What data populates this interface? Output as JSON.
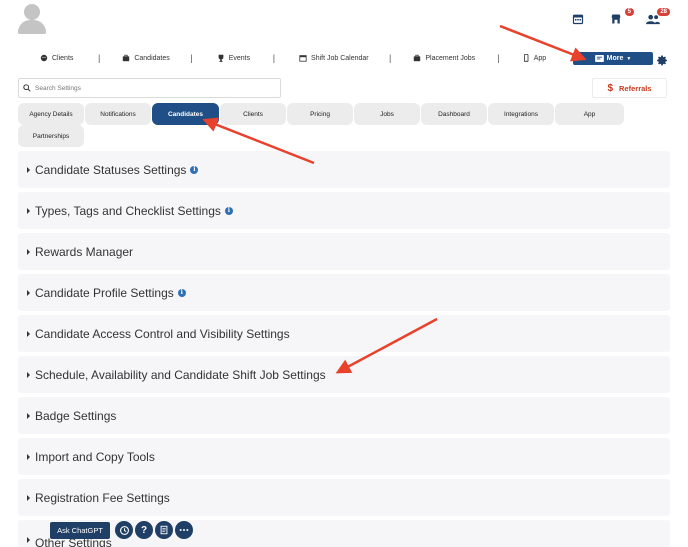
{
  "header": {
    "calendar_icon": "calendar-icon",
    "store_badge": "5",
    "people_badge": "28"
  },
  "nav": {
    "items": [
      {
        "label": "Clients",
        "icon": "clients-icon"
      },
      {
        "label": "Candidates",
        "icon": "candidates-icon"
      },
      {
        "label": "Events",
        "icon": "trophy-icon"
      },
      {
        "label": "Shift Job Calendar",
        "icon": "calendar-icon"
      },
      {
        "label": "Placement Jobs",
        "icon": "briefcase-icon"
      },
      {
        "label": "App",
        "icon": "phone-icon"
      }
    ],
    "more_label": "More"
  },
  "search": {
    "placeholder": "Search Settings"
  },
  "referrals": {
    "label": "Referrals"
  },
  "tabs": [
    {
      "label": "Agency Details"
    },
    {
      "label": "Notifications"
    },
    {
      "label": "Candidates",
      "active": true
    },
    {
      "label": "Clients"
    },
    {
      "label": "Pricing"
    },
    {
      "label": "Jobs"
    },
    {
      "label": "Dashboard"
    },
    {
      "label": "Integrations"
    },
    {
      "label": "App"
    },
    {
      "label": "Partnerships"
    }
  ],
  "sections": [
    {
      "label": "Candidate Statuses Settings",
      "info": true
    },
    {
      "label": "Types, Tags and Checklist Settings",
      "info": true
    },
    {
      "label": "Rewards Manager",
      "info": false
    },
    {
      "label": "Candidate Profile Settings",
      "info": true
    },
    {
      "label": "Candidate Access Control and Visibility Settings",
      "info": false
    },
    {
      "label": "Schedule, Availability and Candidate Shift Job Settings",
      "info": false
    },
    {
      "label": "Badge Settings",
      "info": false
    },
    {
      "label": "Import and Copy Tools",
      "info": false
    },
    {
      "label": "Registration Fee Settings",
      "info": false
    },
    {
      "label": "Other Settings",
      "info": false
    }
  ],
  "toolbar": {
    "ask_label": "Ask ChatGPT"
  },
  "colors": {
    "primary": "#1f4f86",
    "accent_red": "#d9403a",
    "row_bg": "#f6f6f8",
    "tab_bg": "#ececec"
  }
}
